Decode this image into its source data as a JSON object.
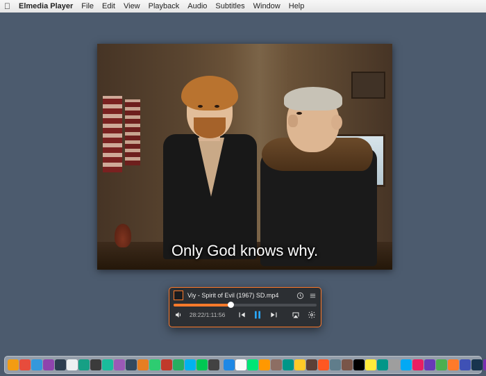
{
  "menubar": {
    "app": "Elmedia Player",
    "items": [
      "File",
      "Edit",
      "View",
      "Playback",
      "Audio",
      "Subtitles",
      "Window",
      "Help"
    ]
  },
  "video": {
    "subtitle": "Only God knows why."
  },
  "panel": {
    "title": "Viy - Spirit of Evil (1967) SD.mp4",
    "elapsed": "28:22",
    "total": "1:11:56",
    "progress_pct": 40
  },
  "dock": {
    "colors": [
      "#f39c12",
      "#e74c3c",
      "#3498db",
      "#8e44ad",
      "#2c3e50",
      "#ecf0f1",
      "#16a085",
      "#3b3b3b",
      "#1abc9c",
      "#9b59b6",
      "#34495e",
      "#e67e22",
      "#2ecc71",
      "#c0392b",
      "#27ae60",
      "#00b2ee",
      "#00c853",
      "#424242",
      "#1e88e5",
      "#fafafa",
      "#00e676",
      "#ff9800",
      "#8d6e63",
      "#009688",
      "#ffca28",
      "#5d4037",
      "#ff5722",
      "#607d8b",
      "#795548",
      "#000000",
      "#ffeb3b",
      "#009688",
      "#9e9e9e",
      "#03a9f4",
      "#e91e63",
      "#673ab7",
      "#4caf50",
      "#ff7a2a",
      "#3f51b5",
      "#18344e",
      "#7a2db0",
      "#ff6a00"
    ]
  }
}
